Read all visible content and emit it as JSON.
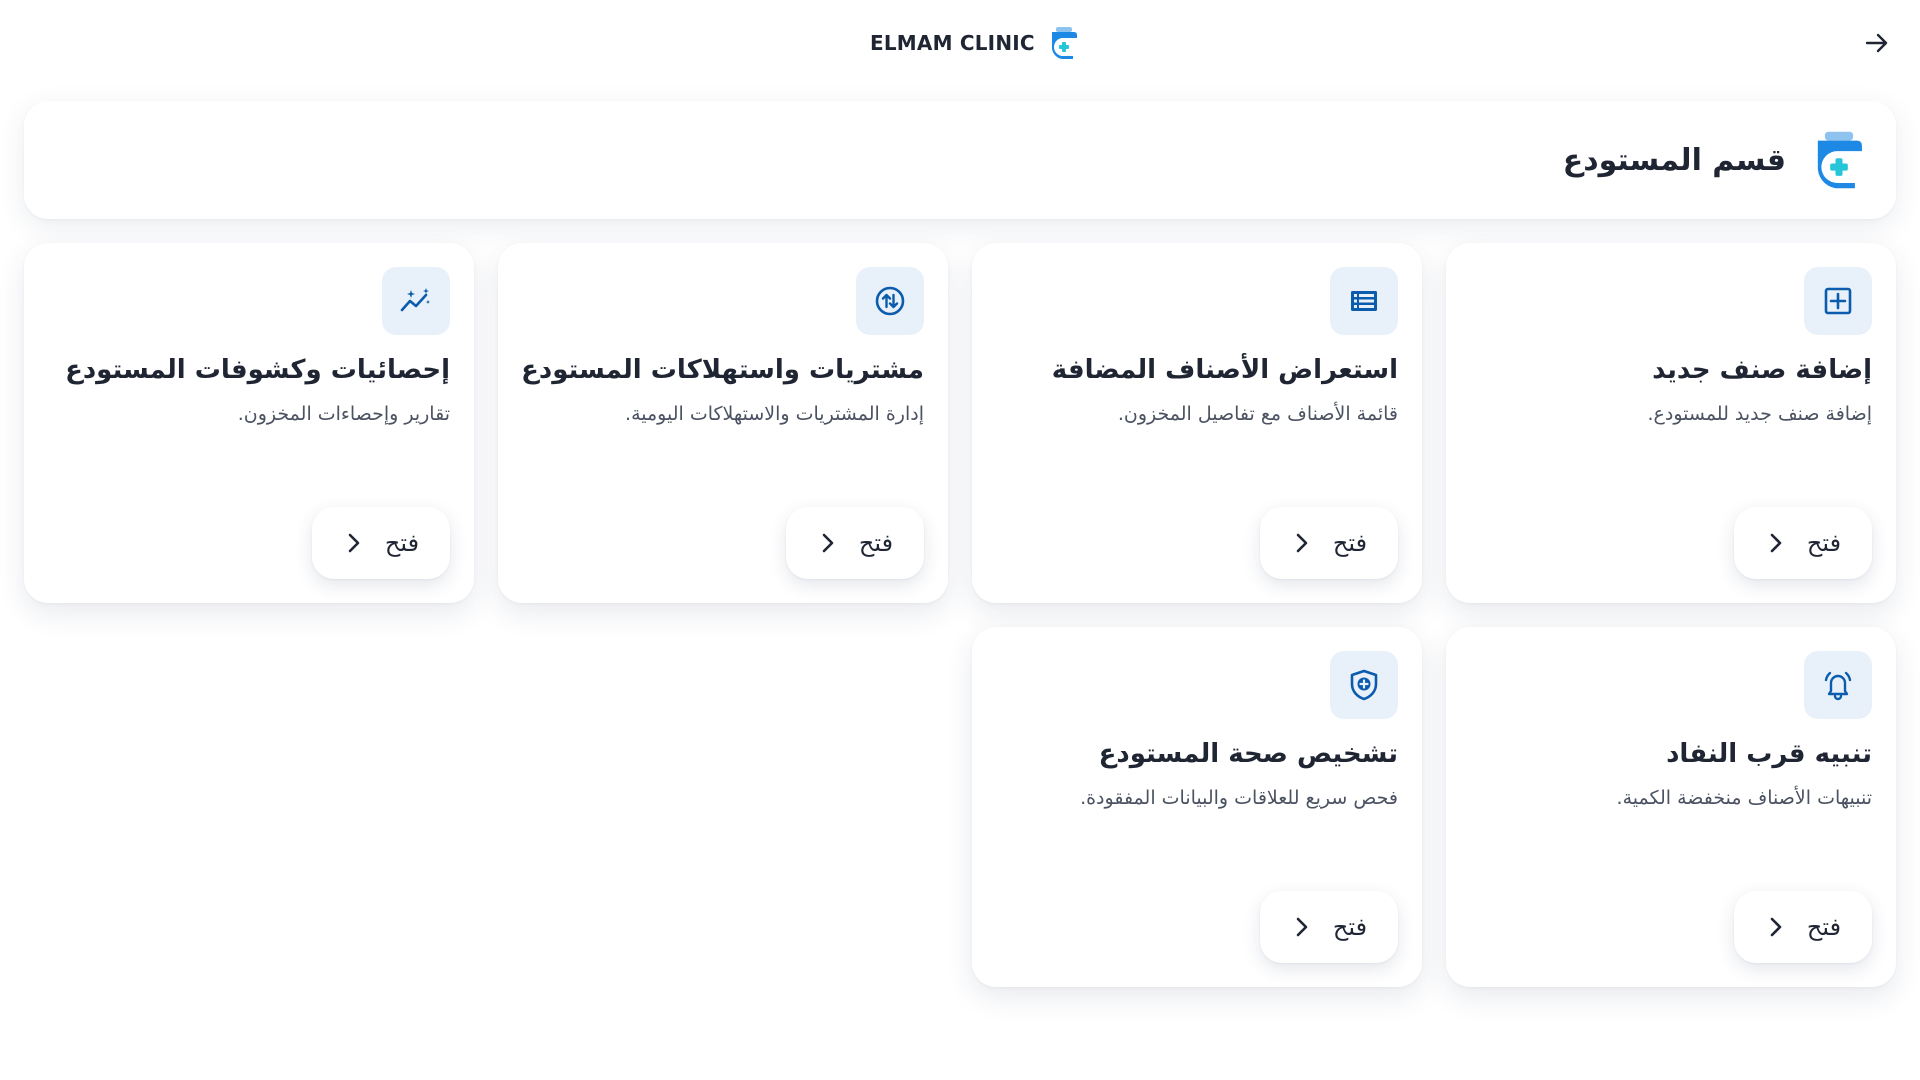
{
  "app": {
    "brand_name": "ELMAM CLINIC",
    "brand_color": "#1e88e5",
    "accent_color": "#0b5cad"
  },
  "topbar": {
    "back_icon": "arrow-right-icon"
  },
  "header": {
    "title": "قسم المستودع",
    "logo_icon": "clinic-logo-icon"
  },
  "cards": [
    {
      "icon": "add-box-icon",
      "title": "إضافة صنف جديد",
      "description": "إضافة صنف جديد للمستودع.",
      "button_label": "فتح"
    },
    {
      "icon": "list-table-icon",
      "title": "استعراض الأصناف المضافة",
      "description": "قائمة الأصناف مع تفاصيل المخزون.",
      "button_label": "فتح"
    },
    {
      "icon": "exchange-arrows-icon",
      "title": "مشتريات واستهلاكات المستودع",
      "description": "إدارة المشتريات والاستهلاكات اليومية.",
      "button_label": "فتح"
    },
    {
      "icon": "sparkle-chart-icon",
      "title": "إحصائيات وكشوفات المستودع",
      "description": "تقارير وإحصاءات المخزون.",
      "button_label": "فتح"
    },
    {
      "icon": "bell-alert-icon",
      "title": "تنبيه قرب النفاد",
      "description": "تنبيهات الأصناف منخفضة الكمية.",
      "button_label": "فتح"
    },
    {
      "icon": "shield-plus-icon",
      "title": "تشخيص صحة المستودع",
      "description": "فحص سريع للعلاقات والبيانات المفقودة.",
      "button_label": "فتح"
    }
  ]
}
